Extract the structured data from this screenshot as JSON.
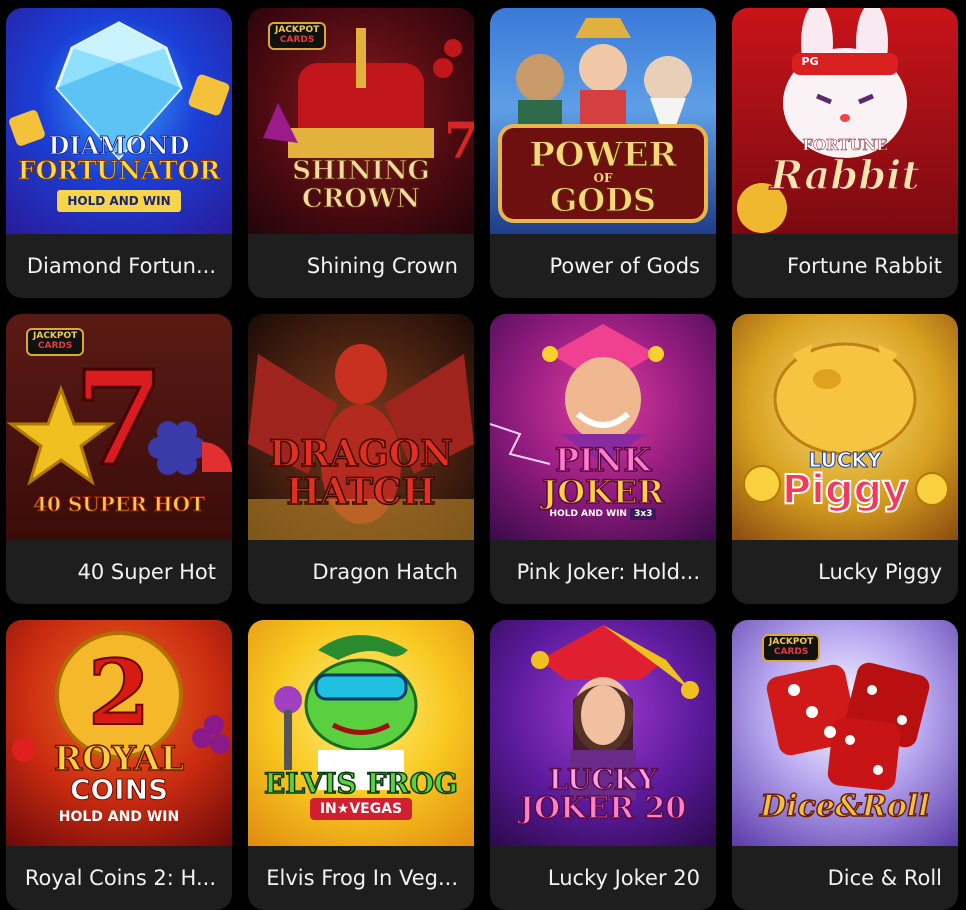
{
  "games": [
    {
      "name": "Diamond Fortun...",
      "art": {
        "lines": [
          "DIAMOND",
          "FORTUNATOR",
          "HOLD AND WIN"
        ]
      }
    },
    {
      "name": "Shining Crown",
      "art": {
        "lines": [
          "SHINING",
          "CROWN"
        ],
        "badge": [
          "JACKPOT",
          "CARDS"
        ]
      }
    },
    {
      "name": "Power of Gods",
      "art": {
        "lines": [
          "POWER",
          "OF",
          "GODS"
        ]
      }
    },
    {
      "name": "Fortune Rabbit",
      "art": {
        "lines": [
          "FORTUNE",
          "Rabbit",
          "PG"
        ]
      }
    },
    {
      "name": "40 Super Hot",
      "art": {
        "lines": [
          "7",
          "40 SUPER HOT"
        ],
        "badge": [
          "JACKPOT",
          "CARDS"
        ]
      }
    },
    {
      "name": "Dragon Hatch",
      "art": {
        "lines": [
          "DRAGON",
          "HATCH"
        ]
      }
    },
    {
      "name": "Pink Joker: Hold...",
      "art": {
        "lines": [
          "PINK",
          "JOKER",
          "HOLD AND WIN",
          "3x3"
        ]
      }
    },
    {
      "name": "Lucky Piggy",
      "art": {
        "lines": [
          "LUCKY",
          "Piggy"
        ]
      }
    },
    {
      "name": "Royal Coins 2: H...",
      "art": {
        "lines": [
          "2",
          "ROYAL",
          "COINS",
          "HOLD AND WIN"
        ]
      }
    },
    {
      "name": "Elvis Frog In Veg...",
      "art": {
        "lines": [
          "ELVIS FROG",
          "IN★VEGAS"
        ]
      }
    },
    {
      "name": "Lucky Joker 20",
      "art": {
        "lines": [
          "LUCKY",
          "JOKER 20"
        ]
      }
    },
    {
      "name": "Dice & Roll",
      "art": {
        "lines": [
          "Dice&Roll"
        ],
        "badge": [
          "JACKPOT",
          "CARDS"
        ]
      }
    }
  ]
}
